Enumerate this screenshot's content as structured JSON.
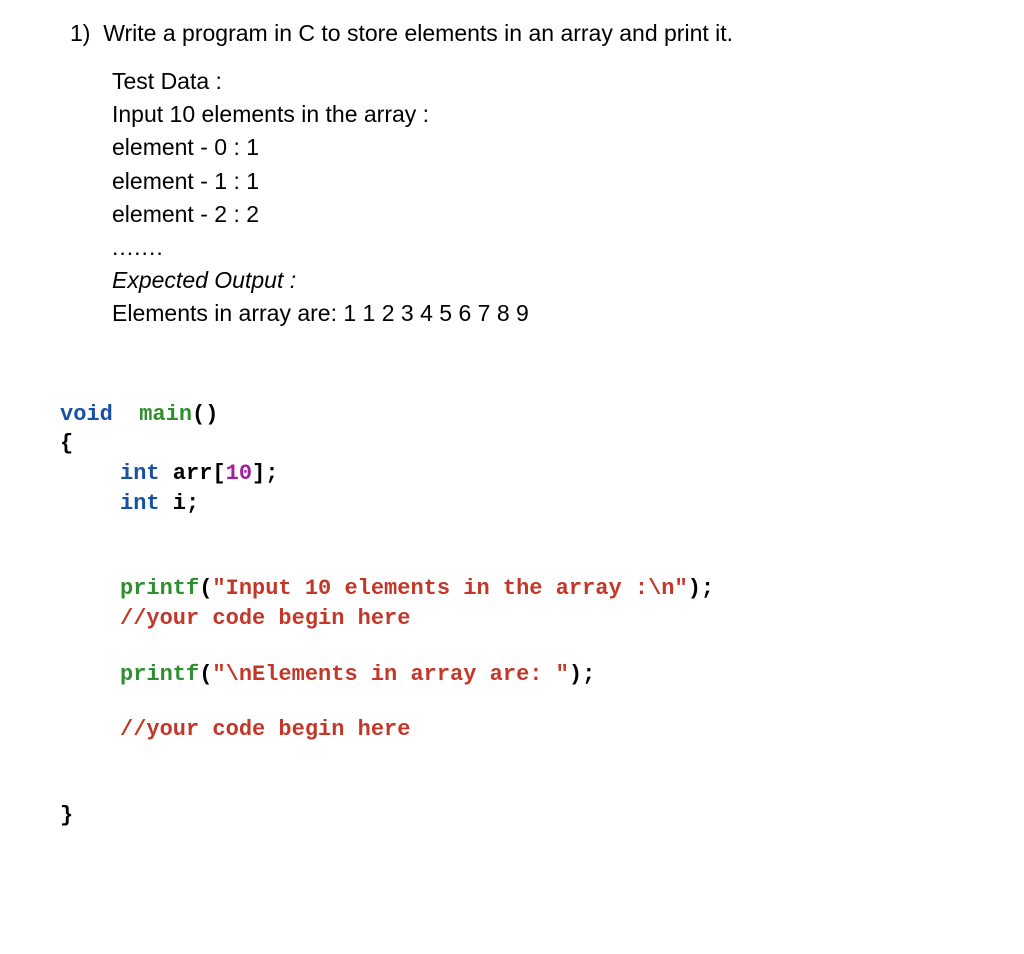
{
  "question": {
    "number": "1)",
    "text": "Write a program in C to store elements in an array and print it."
  },
  "test_data": {
    "header": "Test Data :",
    "input_line": "Input 10 elements in the array :",
    "elements": [
      "element - 0 : 1",
      "element - 1 : 1",
      "element - 2 : 2"
    ],
    "dots": ".......",
    "expected_label": "Expected Output :",
    "expected_value": "Elements in array are: 1 1 2 3 4 5 6 7 8 9"
  },
  "code": {
    "kw_void": "void",
    "fn_main": "main",
    "open_paren": "(",
    "close_paren": ")",
    "open_brace": "{",
    "close_brace": "}",
    "kw_int": "int",
    "arr_decl_name": " arr[",
    "arr_size": "10",
    "arr_decl_end": "];",
    "i_decl": " i;",
    "printf1": "printf",
    "printf1_open": "(",
    "printf1_str": "\"Input 10 elements in the array :\\n\"",
    "printf1_close": ");",
    "comment1": "//your code begin here",
    "printf2": "printf",
    "printf2_open": "(",
    "printf2_str": "\"\\nElements in array are: \"",
    "printf2_close": ");",
    "comment2": "//your code begin here"
  }
}
